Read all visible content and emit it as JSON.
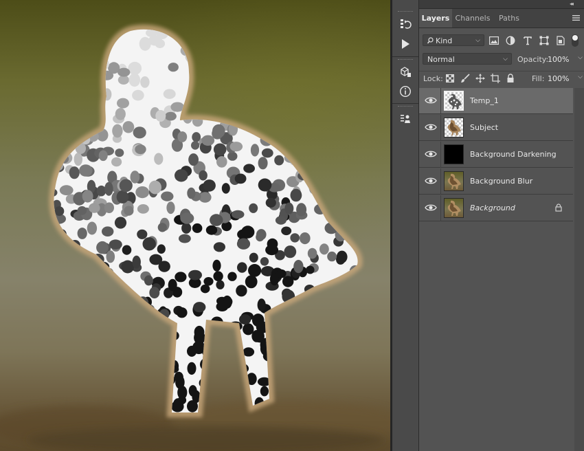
{
  "panel": {
    "collapse_glyph": "◂◂",
    "tabs": [
      {
        "label": "Layers",
        "active": true
      },
      {
        "label": "Channels",
        "active": false
      },
      {
        "label": "Paths",
        "active": false
      }
    ],
    "filter": {
      "selected": "Kind"
    },
    "blend_mode": "Normal",
    "opacity_label": "Opacity:",
    "opacity_value": "100%",
    "lock_label": "Lock:",
    "fill_label": "Fill:",
    "fill_value": "100%"
  },
  "layers": [
    {
      "name": "Temp_1",
      "thumb": "pointillize",
      "selected": true,
      "visible": true,
      "italic": false,
      "locked": false
    },
    {
      "name": "Subject",
      "thumb": "subject",
      "selected": false,
      "visible": true,
      "italic": false,
      "locked": false
    },
    {
      "name": "Background Darkening",
      "thumb": "black",
      "selected": false,
      "visible": true,
      "italic": false,
      "locked": false
    },
    {
      "name": "Background Blur",
      "thumb": "photo",
      "selected": false,
      "visible": true,
      "italic": false,
      "locked": false
    },
    {
      "name": "Background",
      "thumb": "photo",
      "selected": false,
      "visible": true,
      "italic": true,
      "locked": true
    }
  ],
  "colors": {
    "panel_bg": "#535353",
    "selected_row": "#6a6a6a",
    "tab_bar": "#424242"
  }
}
